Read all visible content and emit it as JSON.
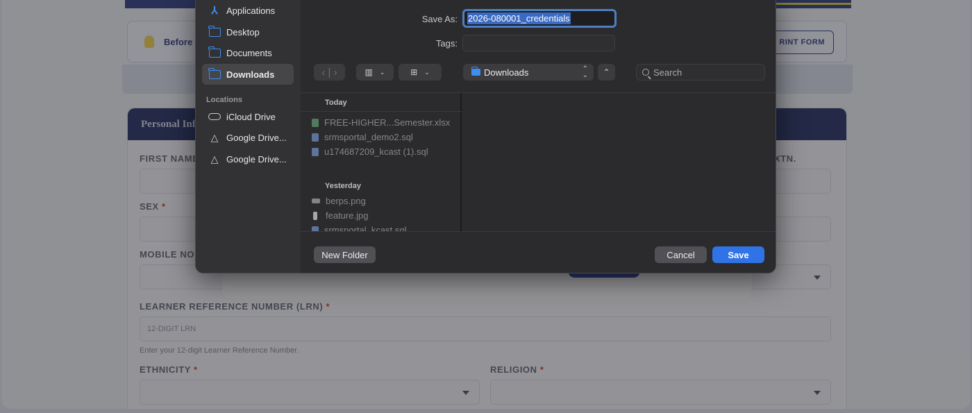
{
  "background_page": {
    "notice_text": "Before r",
    "print_button": "RINT FORM",
    "section_title": "Personal Inf",
    "fields": {
      "first_name": "FIRST NAME",
      "extn": "XTN.",
      "sex": "SEX",
      "mobile": "MOBILE NO",
      "lrn": "LEARNER REFERENCE NUMBER (LRN)",
      "lrn_placeholder": "12-DIGIT LRN",
      "lrn_hint": "Enter your 12-digit Learner Reference Number.",
      "ethnicity": "ETHNICITY",
      "religion": "RELIGION",
      "required_mark": "*"
    }
  },
  "dialog": {
    "save_as_label": "Save As:",
    "save_as_value": "2026-080001_credentials",
    "tags_label": "Tags:",
    "sidebar": {
      "favorites": [
        {
          "label": "Applications",
          "icon": "applications-icon"
        },
        {
          "label": "Desktop",
          "icon": "folder-icon"
        },
        {
          "label": "Documents",
          "icon": "folder-icon"
        },
        {
          "label": "Downloads",
          "icon": "folder-icon",
          "selected": true
        }
      ],
      "locations_header": "Locations",
      "locations": [
        {
          "label": "iCloud Drive",
          "icon": "cloud-icon"
        },
        {
          "label": "Google Drive...",
          "icon": "google-drive-icon"
        },
        {
          "label": "Google Drive...",
          "icon": "google-drive-icon"
        }
      ]
    },
    "toolbar": {
      "back_forward": "‹ | ›",
      "location": "Downloads",
      "search_placeholder": "Search"
    },
    "files": {
      "today_label": "Today",
      "today": [
        "FREE-HIGHER...Semester.xlsx",
        "srmsportal_demo2.sql",
        "u174687209_kcast (1).sql"
      ],
      "yesterday_label": "Yesterday",
      "yesterday": [
        "berps.png",
        "feature.jpg",
        "srmsportal_kcast.sql"
      ]
    },
    "buttons": {
      "new_folder": "New Folder",
      "cancel": "Cancel",
      "save": "Save"
    },
    "colors": {
      "accent": "#2f73e6",
      "selection": "#3a6bc4",
      "folder": "#3d8ef0"
    }
  }
}
